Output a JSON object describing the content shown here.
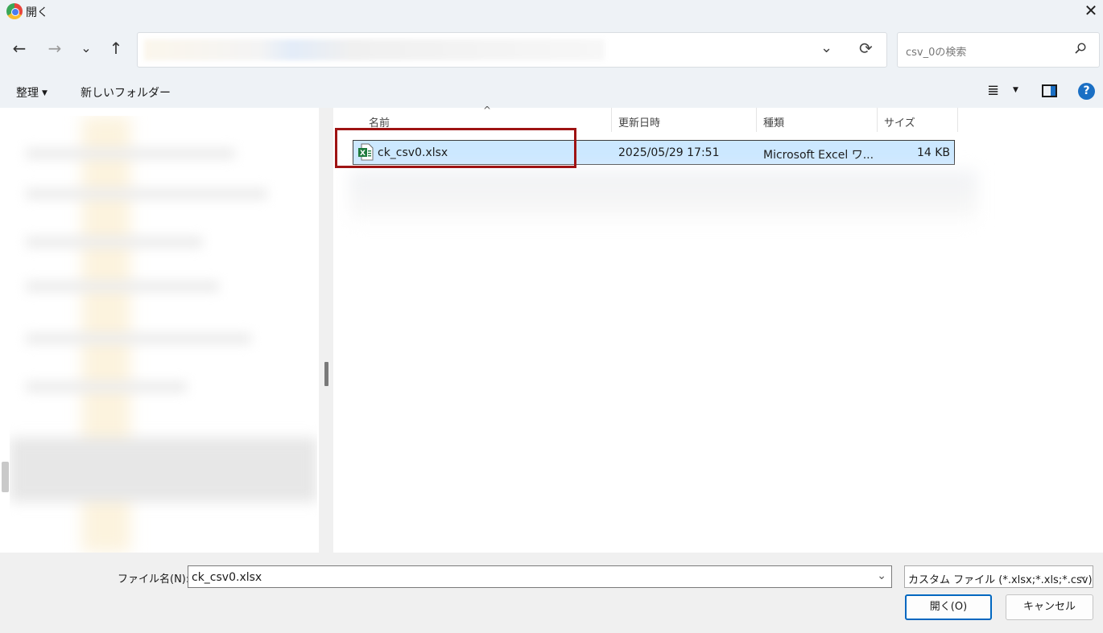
{
  "window": {
    "title": "開く",
    "close_glyph": "✕"
  },
  "nav": {
    "back": "←",
    "forward": "→",
    "recent": "⌄",
    "up": "↑"
  },
  "addressbar": {
    "dropdown_glyph": "⌄",
    "refresh_glyph": "⟳"
  },
  "search": {
    "placeholder": "csv_0の検索"
  },
  "toolbar": {
    "organize_label": "整理",
    "organize_caret": "▼",
    "new_folder_label": "新しいフォルダー",
    "view_glyph": "≣",
    "view_caret": "▼",
    "help_glyph": "?"
  },
  "columns": {
    "name": "名前",
    "modified": "更新日時",
    "type": "種類",
    "size": "サイズ",
    "sort_glyph": "^"
  },
  "files": [
    {
      "name": "ck_csv0.xlsx",
      "modified": "2025/05/29 17:51",
      "type": "Microsoft Excel ワ...",
      "size": "14 KB",
      "selected": true
    }
  ],
  "footer": {
    "filename_label": "ファイル名(N):",
    "filename_value": "ck_csv0.xlsx",
    "dropdown_glyph": "⌄",
    "filter_value": "カスタム ファイル (*.xlsx;*.xls;*.csv)",
    "open_label": "開く(O)",
    "cancel_label": "キャンセル"
  },
  "colors": {
    "selection": "#cce8ff",
    "highlight_box": "#9e1313",
    "accent": "#0067c0",
    "chrome": "#eef2f6"
  }
}
